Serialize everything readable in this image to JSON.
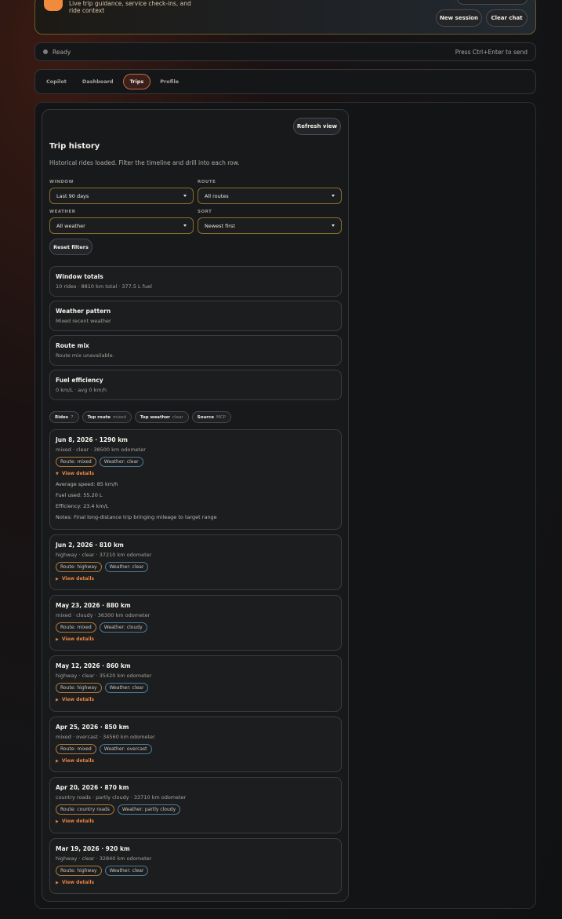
{
  "header": {
    "description": "Live trip guidance, service check-ins, and ride context",
    "new_session_label": "New session",
    "clear_chat_label": "Clear chat"
  },
  "status": {
    "text": "Ready",
    "hint": "Press Ctrl+Enter to send"
  },
  "tabs": [
    {
      "label": "Copilot",
      "active": false
    },
    {
      "label": "Dashboard",
      "active": false
    },
    {
      "label": "Trips",
      "active": true
    },
    {
      "label": "Profile",
      "active": false
    }
  ],
  "trips": {
    "refresh_label": "Refresh view",
    "title": "Trip history",
    "subtitle": "Historical rides loaded. Filter the timeline and drill into each row.",
    "filters": {
      "window": {
        "label": "WINDOW",
        "value": "Last 90 days"
      },
      "route": {
        "label": "ROUTE",
        "value": "All routes"
      },
      "weather": {
        "label": "WEATHER",
        "value": "All weather"
      },
      "sort": {
        "label": "SORT",
        "value": "Newest first"
      }
    },
    "reset_label": "Reset filters",
    "summaries": [
      {
        "title": "Window totals",
        "text": "10 rides · 8810 km total · 377.5 L fuel"
      },
      {
        "title": "Weather pattern",
        "text": "Mixed recent weather"
      },
      {
        "title": "Route mix",
        "text": "Route mix unavailable."
      },
      {
        "title": "Fuel efficiency",
        "text": "0 km/L · avg 0 km/h"
      }
    ],
    "stats": [
      {
        "key": "Rides",
        "value": "7"
      },
      {
        "key": "Top route",
        "value": "mixed"
      },
      {
        "key": "Top weather",
        "value": "clear"
      },
      {
        "key": "Source",
        "value": "MCP"
      }
    ],
    "details_label": "View details",
    "rows": [
      {
        "title": "Jun 8, 2026 · 1290 km",
        "sub": "mixed · clear · 38500 km odometer",
        "route_tag": "Route: mixed",
        "weather_tag": "Weather: clear",
        "expanded": true,
        "details": [
          "Average speed: 85 km/h",
          "Fuel used: 55.20 L",
          "Efficiency: 23.4 km/L",
          "Notes: Final long-distance trip bringing mileage to target range"
        ]
      },
      {
        "title": "Jun 2, 2026 · 810 km",
        "sub": "highway · clear · 37210 km odometer",
        "route_tag": "Route: highway",
        "weather_tag": "Weather: clear"
      },
      {
        "title": "May 23, 2026 · 880 km",
        "sub": "mixed · cloudy · 36300 km odometer",
        "route_tag": "Route: mixed",
        "weather_tag": "Weather: cloudy"
      },
      {
        "title": "May 12, 2026 · 860 km",
        "sub": "highway · clear · 35420 km odometer",
        "route_tag": "Route: highway",
        "weather_tag": "Weather: clear"
      },
      {
        "title": "Apr 25, 2026 · 850 km",
        "sub": "mixed · overcast · 34560 km odometer",
        "route_tag": "Route: mixed",
        "weather_tag": "Weather: overcast"
      },
      {
        "title": "Apr 20, 2026 · 870 km",
        "sub": "country roads · partly cloudy · 33710 km odometer",
        "route_tag": "Route: country roads",
        "weather_tag": "Weather: partly cloudy"
      },
      {
        "title": "Mar 19, 2026 · 920 km",
        "sub": "highway · clear · 32840 km odometer",
        "route_tag": "Route: highway",
        "weather_tag": "Weather: clear"
      }
    ]
  }
}
